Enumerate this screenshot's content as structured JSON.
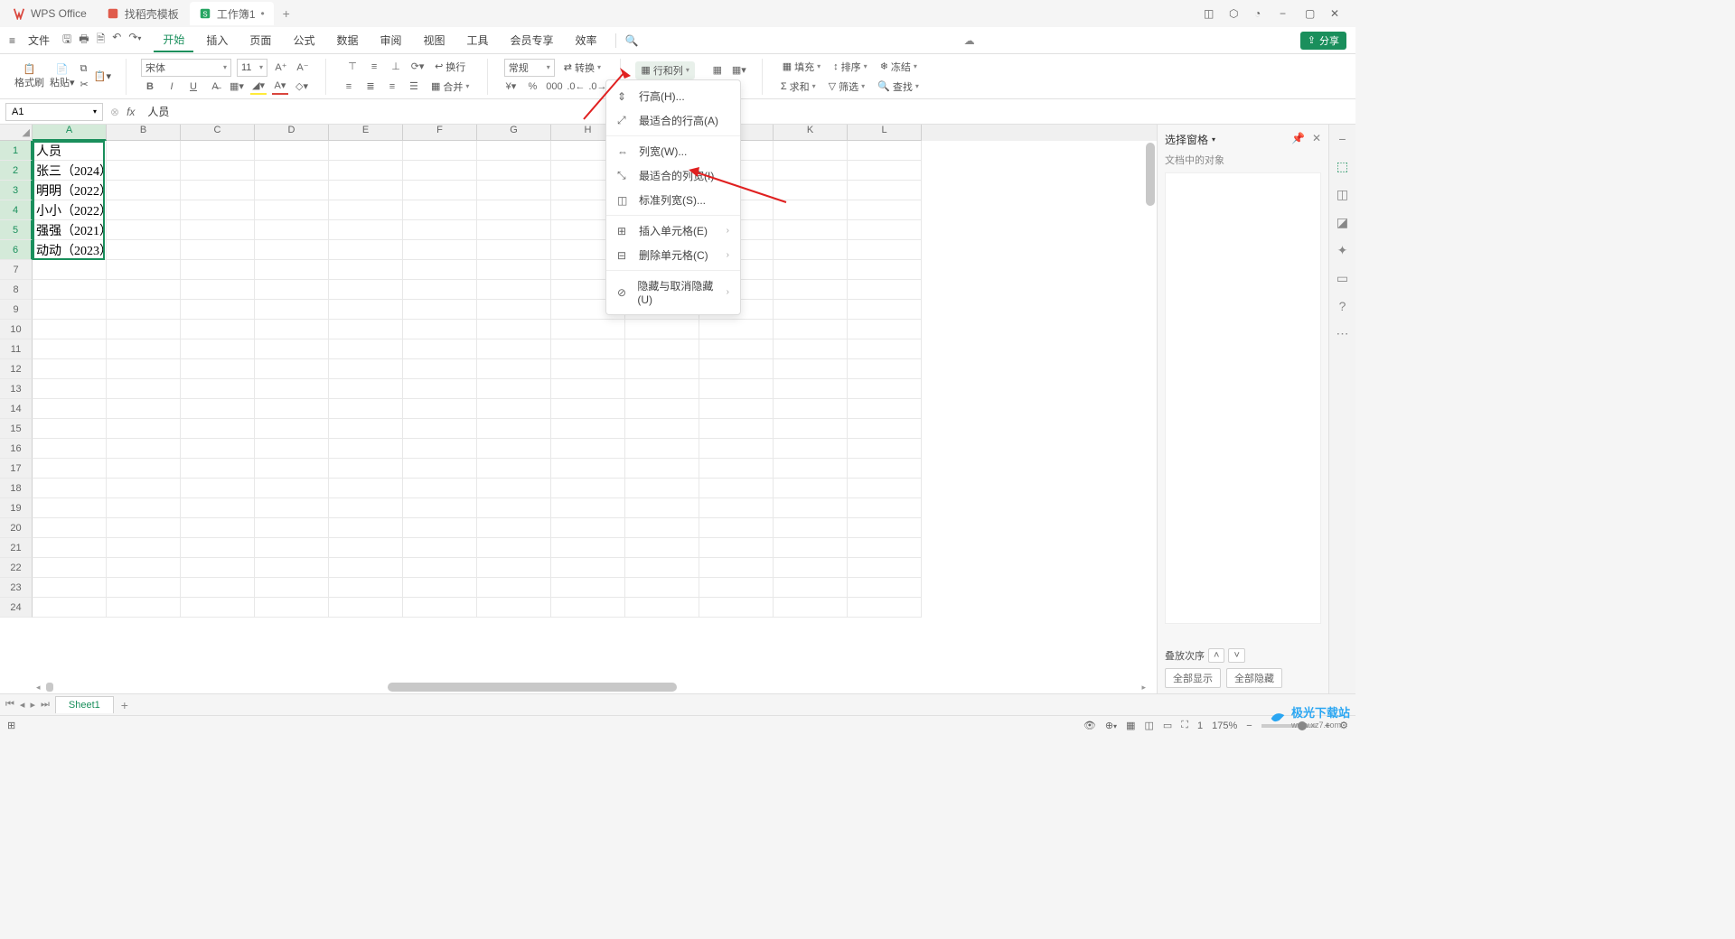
{
  "tabs": [
    {
      "label": "WPS Office",
      "icon": "wps"
    },
    {
      "label": "找稻壳模板",
      "icon": "doc"
    },
    {
      "label": "工作簿1",
      "icon": "sheet",
      "active": true
    }
  ],
  "menubar": {
    "file_label": "文件",
    "items": [
      "开始",
      "插入",
      "页面",
      "公式",
      "数据",
      "审阅",
      "视图",
      "工具",
      "会员专享",
      "效率"
    ],
    "active_index": 0,
    "share_label": "分享"
  },
  "toolbar": {
    "format_brush": "格式刷",
    "paste": "粘贴",
    "font_name": "宋体",
    "font_size": "11",
    "wrap": "换行",
    "numfmt": "常规",
    "convert": "转换",
    "rowcol": "行和列",
    "fill": "填充",
    "sort": "排序",
    "freeze": "冻结",
    "sum": "求和",
    "filter": "筛选",
    "find": "查找",
    "mergecenter": "合并"
  },
  "formulabar": {
    "cell": "A1",
    "value": "人员"
  },
  "columns": [
    "A",
    "B",
    "C",
    "D",
    "E",
    "F",
    "G",
    "H",
    "I",
    "J",
    "K",
    "L"
  ],
  "rows": [
    1,
    2,
    3,
    4,
    5,
    6,
    7,
    8,
    9,
    10,
    11,
    12,
    13,
    14,
    15,
    16,
    17,
    18,
    19,
    20,
    21,
    22,
    23,
    24
  ],
  "data_a": [
    "人员",
    "张三（2024）",
    "明明（2022）",
    "小小（2022）",
    "强强（2021）",
    "动动（2023）"
  ],
  "dropdown": {
    "row_height": "行高(H)...",
    "fit_row": "最适合的行高(A)",
    "col_width": "列宽(W)...",
    "fit_col": "最适合的列宽(I)",
    "std_col": "标准列宽(S)...",
    "insert_cell": "插入单元格(E)",
    "delete_cell": "删除单元格(C)",
    "hide_unhide": "隐藏与取消隐藏(U)"
  },
  "rightpanel": {
    "title": "选择窗格",
    "subtitle": "文档中的对象",
    "sort_label": "叠放次序",
    "show_all": "全部显示",
    "hide_all": "全部隐藏"
  },
  "sheetbar": {
    "name": "Sheet1"
  },
  "statusbar": {
    "zoom": "175%",
    "page": "1"
  },
  "watermark": {
    "brand": "极光下载站",
    "url": "www.xz7.com"
  }
}
